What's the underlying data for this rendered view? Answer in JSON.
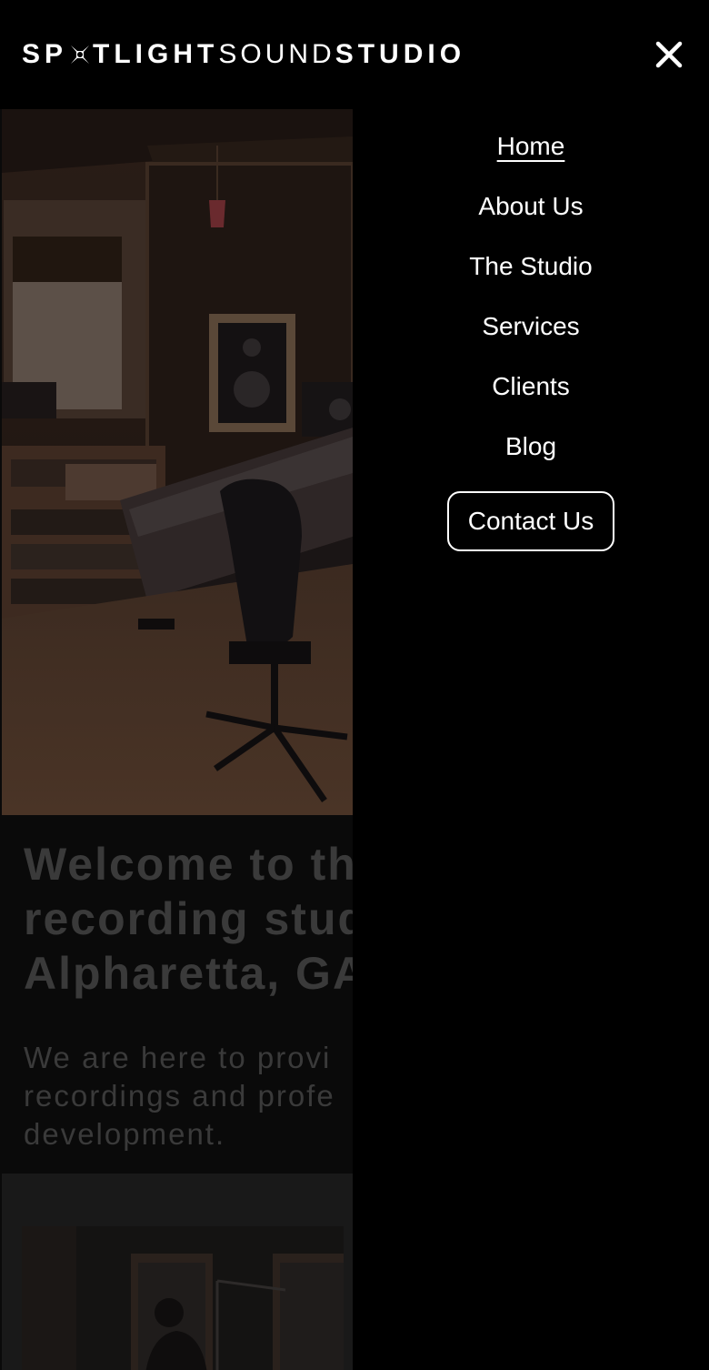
{
  "header": {
    "logo_part1": "SP",
    "logo_part2": "TLIGHT",
    "logo_part3": "SOUND",
    "logo_part4": "STUDIO",
    "close_icon": "close-icon"
  },
  "nav": {
    "items": [
      {
        "label": "Home",
        "active": true
      },
      {
        "label": "About Us"
      },
      {
        "label": "The Studio"
      },
      {
        "label": "Services"
      },
      {
        "label": "Clients"
      },
      {
        "label": "Blog"
      }
    ],
    "contact_label": "Contact Us"
  },
  "page": {
    "heading": "Welcome to th\nrecording stud\nAlpharetta, GA",
    "subtext": "We are here to provi\nrecordings and profe\ndevelopment."
  },
  "colors": {
    "background": "#000000",
    "text": "#ffffff",
    "dimmed_text": "#3a3a3a"
  }
}
